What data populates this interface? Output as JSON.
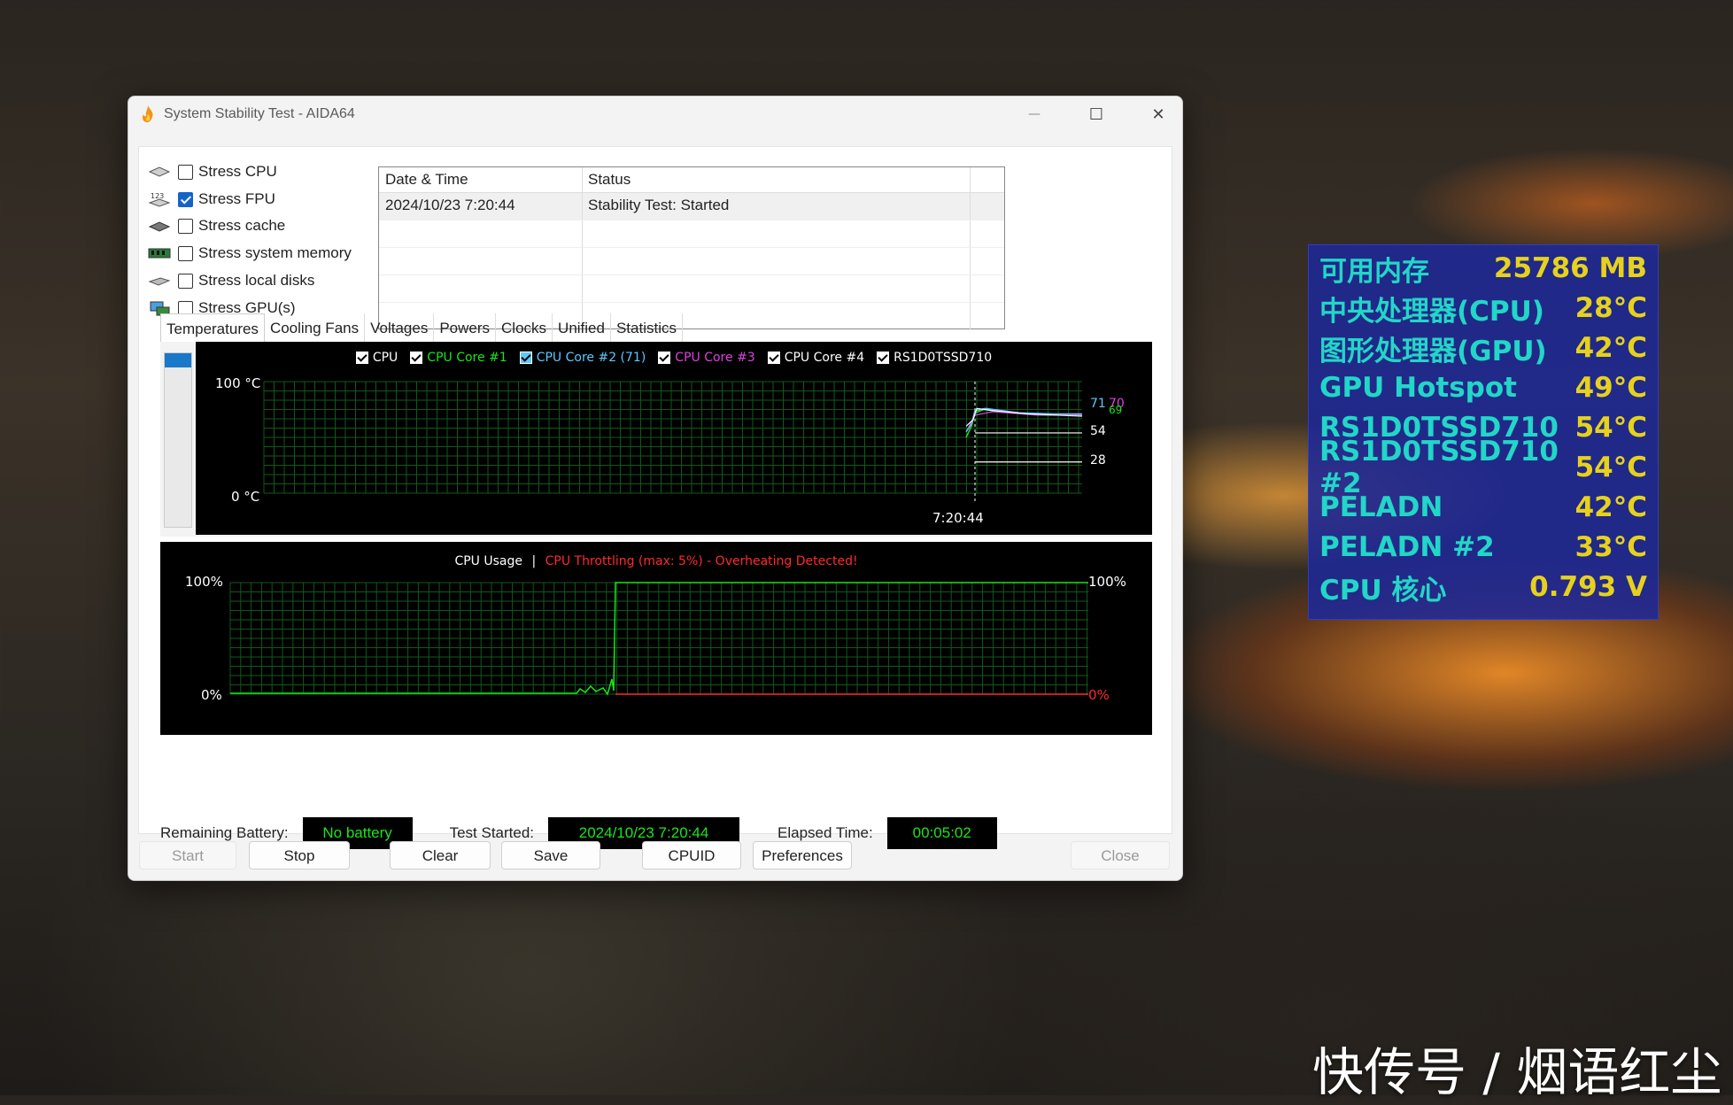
{
  "window": {
    "title": "System Stability Test - AIDA64",
    "controls": {
      "minimize": "—",
      "maximize": "☐",
      "close": "✕"
    }
  },
  "options": [
    {
      "label": "Stress CPU",
      "checked": false,
      "icon": "cpu-chip-icon"
    },
    {
      "label": "Stress FPU",
      "checked": true,
      "icon": "fpu-123-icon"
    },
    {
      "label": "Stress cache",
      "checked": false,
      "icon": "cache-chip-icon"
    },
    {
      "label": "Stress system memory",
      "checked": false,
      "icon": "memory-module-icon"
    },
    {
      "label": "Stress local disks",
      "checked": false,
      "icon": "disk-drive-icon"
    },
    {
      "label": "Stress GPU(s)",
      "checked": false,
      "icon": "gpu-card-icon"
    }
  ],
  "log": {
    "headers": [
      "Date & Time",
      "Status"
    ],
    "rows": [
      {
        "datetime": "2024/10/23 7:20:44",
        "status": "Stability Test: Started"
      }
    ]
  },
  "tabs": [
    "Temperatures",
    "Cooling Fans",
    "Voltages",
    "Powers",
    "Clocks",
    "Unified",
    "Statistics"
  ],
  "temp_graph": {
    "legend": [
      {
        "label": "CPU",
        "color": "#ffffff"
      },
      {
        "label": "CPU Core #1",
        "color": "#19e619"
      },
      {
        "label": "CPU Core #2 (71)",
        "color": "#5ec8ff"
      },
      {
        "label": "CPU Core #3",
        "color": "#e040e0"
      },
      {
        "label": "CPU Core #4",
        "color": "#ffffff"
      },
      {
        "label": "RS1D0TSSD710",
        "color": "#ffffff"
      }
    ],
    "y_top_label": "100 °C",
    "y_bottom_label": "0 °C",
    "x_time_label": "7:20:44",
    "right_labels": [
      "71",
      "70",
      "69",
      "54",
      "28"
    ]
  },
  "cpu_graph": {
    "title": "CPU Usage",
    "separator": "|",
    "throttle_text": "CPU Throttling (max: 5%) - Overheating Detected!",
    "left_top": "100%",
    "left_bottom": "0%",
    "right_top": "100%",
    "right_bottom": "0%"
  },
  "status": {
    "battery_label": "Remaining Battery:",
    "battery_value": "No battery",
    "started_label": "Test Started:",
    "started_value": "2024/10/23 7:20:44",
    "elapsed_label": "Elapsed Time:",
    "elapsed_value": "00:05:02"
  },
  "buttons": {
    "start": "Start",
    "stop": "Stop",
    "clear": "Clear",
    "save": "Save",
    "cpuid": "CPUID",
    "preferences": "Preferences",
    "close": "Close"
  },
  "osd": [
    {
      "label": "可用内存",
      "value": "25786 MB"
    },
    {
      "label": "中央处理器(CPU)",
      "value": "28°C"
    },
    {
      "label": "图形处理器(GPU)",
      "value": "42°C"
    },
    {
      "label": "GPU Hotspot",
      "value": "49°C"
    },
    {
      "label": "RS1D0TSSD710",
      "value": "54°C"
    },
    {
      "label": "RS1D0TSSD710 #2",
      "value": "54°C"
    },
    {
      "label": "PELADN",
      "value": "42°C"
    },
    {
      "label": "PELADN #2",
      "value": "33°C"
    },
    {
      "label": "CPU 核心",
      "value": "0.793 V"
    }
  ],
  "watermark": "快传号 / 烟语红尘",
  "colors": {
    "graph_grid": "#0f5a1a",
    "graph_value": "#19e619",
    "throttle_red": "#ff2a2a",
    "osd_bg": "#1e2896",
    "osd_label": "#22d6c8",
    "osd_value": "#e6d21c"
  }
}
